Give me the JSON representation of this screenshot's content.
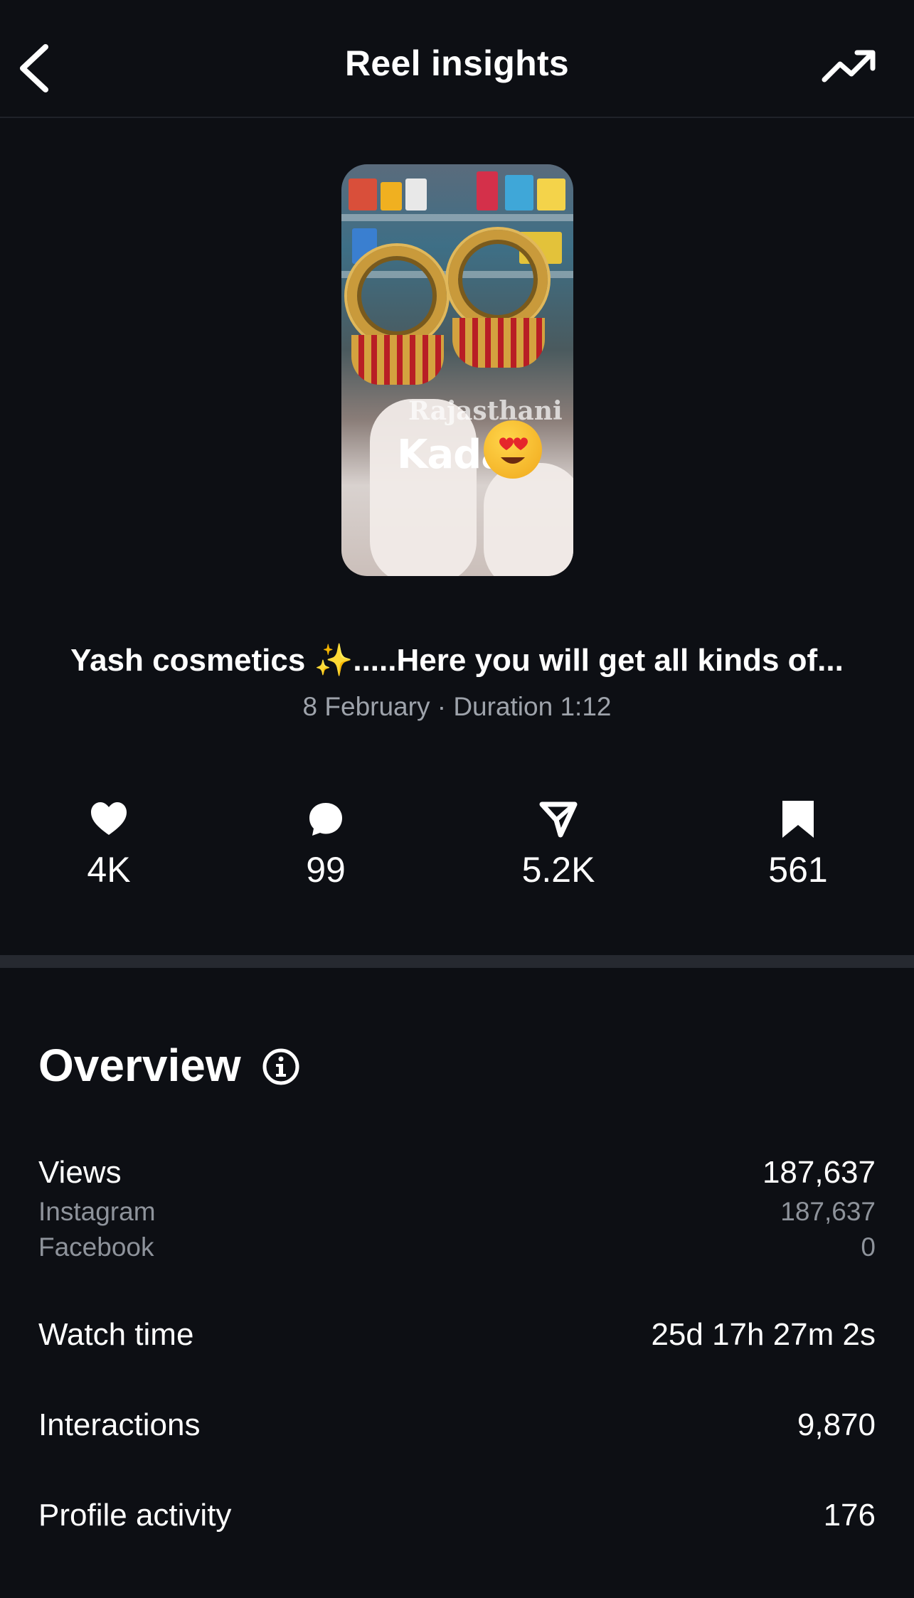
{
  "header": {
    "title": "Reel insights",
    "back_icon": "chevron-left-icon",
    "trend_icon": "trending-up-icon"
  },
  "thumbnail": {
    "overlay_small": "Rajasthani",
    "overlay_big": "Kada"
  },
  "post": {
    "title": "Yash cosmetics ✨.....Here you will get all kinds of...",
    "meta": "8 February · Duration 1:12"
  },
  "stats": {
    "likes": "4K",
    "comments": "99",
    "shares": "5.2K",
    "saves": "561"
  },
  "overview": {
    "title": "Overview",
    "views_label": "Views",
    "views_value": "187,637",
    "instagram_label": "Instagram",
    "instagram_value": "187,637",
    "facebook_label": "Facebook",
    "facebook_value": "0",
    "watch_time_label": "Watch time",
    "watch_time_value": "25d 17h 27m 2s",
    "interactions_label": "Interactions",
    "interactions_value": "9,870",
    "profile_activity_label": "Profile activity",
    "profile_activity_value": "176"
  },
  "colors": {
    "background": "#0d0f14",
    "text_primary": "#ffffff",
    "text_secondary": "#8e939b",
    "divider": "#262930"
  }
}
